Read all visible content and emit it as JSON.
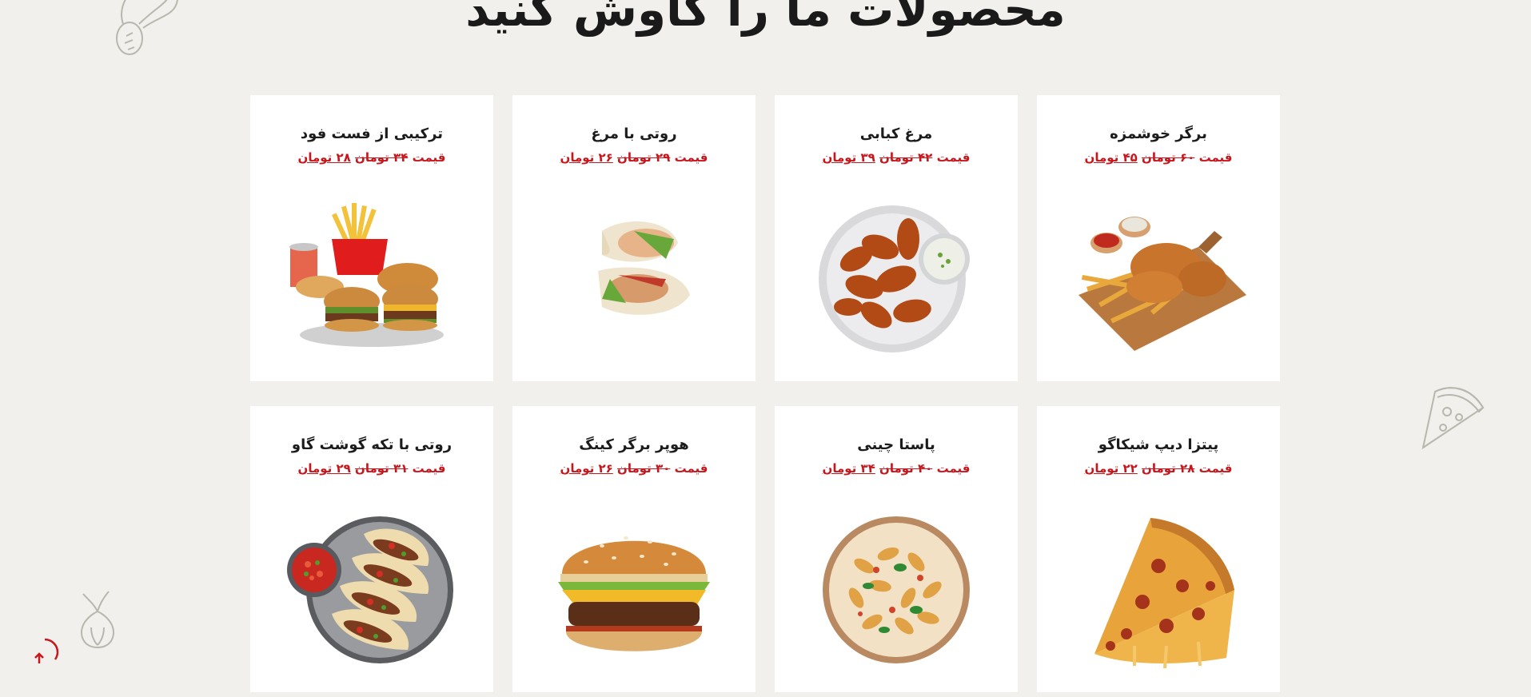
{
  "section": {
    "title": "محصولات ما را کاوش کنید"
  },
  "products": [
    {
      "name": "برگر خوشمزه",
      "price_label": "قیمت",
      "old_price": "۶۰ تومان",
      "new_price": "۴۵ تومان",
      "image_icon": "fried-chicken-fries-board-image"
    },
    {
      "name": "مرغ کبابی",
      "price_label": "قیمت",
      "old_price": "۴۲ تومان",
      "new_price": "۳۹ تومان",
      "image_icon": "chicken-wings-plate-image"
    },
    {
      "name": "روتی با مرغ",
      "price_label": "قیمت",
      "old_price": "۲۹ تومان",
      "new_price": "۲۶ تومان",
      "image_icon": "chicken-wrap-image"
    },
    {
      "name": "ترکیبی از فست فود",
      "price_label": "قیمت",
      "old_price": "۳۴ تومان",
      "new_price": "۲۸ تومان",
      "image_icon": "fast-food-combo-image"
    },
    {
      "name": "پیتزا دیپ شیکاگو",
      "price_label": "قیمت",
      "old_price": "۲۸ تومان",
      "new_price": "۲۲ تومان",
      "image_icon": "pizza-slice-image"
    },
    {
      "name": "پاستا چینی",
      "price_label": "قیمت",
      "old_price": "۴۰ تومان",
      "new_price": "۳۴ تومان",
      "image_icon": "pasta-bowl-image"
    },
    {
      "name": "هوپر برگر کینگ",
      "price_label": "قیمت",
      "old_price": "۳۰ تومان",
      "new_price": "۲۶ تومان",
      "image_icon": "burger-image"
    },
    {
      "name": "روتی با تکه گوشت گاو",
      "price_label": "قیمت",
      "old_price": "۳۱ تومان",
      "new_price": "۲۹ تومان",
      "image_icon": "beef-tacos-image"
    }
  ],
  "colors": {
    "background": "#f1f0ec",
    "price": "#c8161d",
    "card": "#ffffff",
    "title": "#1a1a1a"
  }
}
